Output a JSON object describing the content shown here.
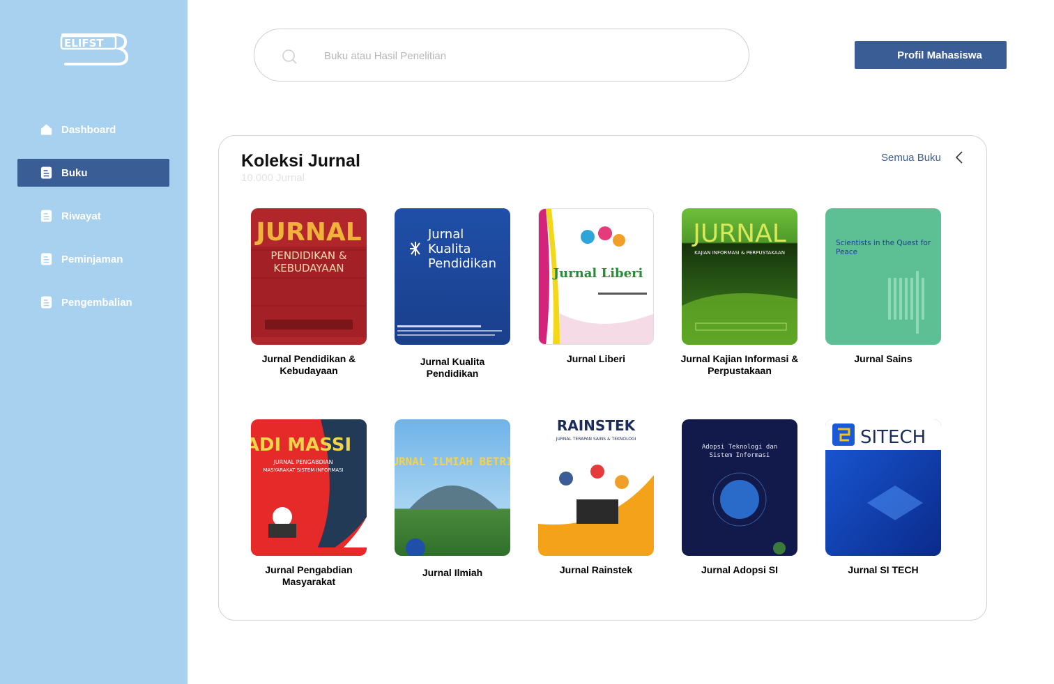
{
  "logo": {
    "text": "ELIFST"
  },
  "sidebar": {
    "items": [
      {
        "label": "Dashboard",
        "icon": "home-icon"
      },
      {
        "label": "Buku",
        "icon": "document-icon"
      },
      {
        "label": "Riwayat",
        "icon": "document-icon"
      },
      {
        "label": "Peminjaman",
        "icon": "document-icon"
      },
      {
        "label": "Pengembalian",
        "icon": "document-icon"
      }
    ],
    "active_index": 1
  },
  "search": {
    "placeholder": "Buku atau Hasil Penelitian",
    "value": ""
  },
  "header": {
    "profile_button": "Profil Mahasiswa"
  },
  "collection": {
    "title": "Koleksi Jurnal",
    "count": "10.000 Jurnal",
    "all_link": "Semua Buku",
    "books": [
      {
        "title": "Jurnal Pendidikan & Kebudayaan",
        "cover_text": [
          "JURNAL",
          "PENDIDIKAN &",
          "KEBUDAYAAN"
        ]
      },
      {
        "title": "Jurnal Kualita Pendidikan",
        "cover_text": [
          "Jurnal",
          "Kualita",
          "Pendidikan"
        ]
      },
      {
        "title": "Jurnal Liberi",
        "cover_text": [
          "Jurnal Liberi"
        ]
      },
      {
        "title": "Jurnal Kajian Informasi & Perpustakaan",
        "cover_text": [
          "JURNAL",
          "KAJIAN INFORMASI & PERPUSTAKAAN"
        ]
      },
      {
        "title": "Jurnal Sains",
        "cover_text": [
          "Scientists in the Quest for",
          "Peace"
        ]
      },
      {
        "title": "Jurnal Pengabdian Masyarakat",
        "cover_text": [
          "ADI MASSI",
          "JURNAL PENGABDIAN",
          "MASYARAKAT SISTEM INFORMASI"
        ]
      },
      {
        "title": "Jurnal Ilmiah",
        "cover_text": [
          "JURNAL ILMIAH BETRIK"
        ]
      },
      {
        "title": "Jurnal Rainstek",
        "cover_text": [
          "RAINSTEK",
          "JURNAL TERAPAN SAINS & TEKNOLOGI"
        ]
      },
      {
        "title": "Jurnal Adopsi SI",
        "cover_text": [
          "Adopsi Teknologi dan",
          "Sistem Informasi"
        ]
      },
      {
        "title": "Jurnal SI TECH",
        "cover_text": [
          "SITECH"
        ]
      }
    ]
  }
}
